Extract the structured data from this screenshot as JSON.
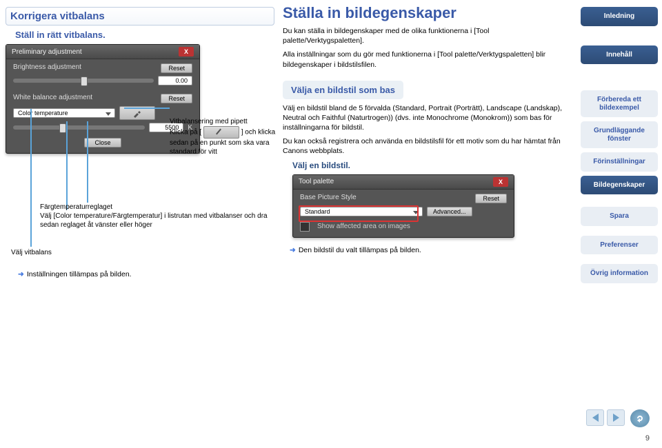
{
  "left": {
    "heading": "Korrigera vitbalans",
    "subStatement": "Ställ in rätt vitbalans.",
    "panel": {
      "title": "Preliminary adjustment",
      "brightnessLabel": "Brightness adjustment",
      "resetLabel": "Reset",
      "brightnessValue": "0.00",
      "whiteBalanceLabel": "White balance adjustment",
      "dropdownValue": "Color temperature",
      "kelvinValue": "5500",
      "kelvinUnit": "K",
      "closeLabel": "Close"
    },
    "annotPipette": "Vitbalansering med pipett",
    "annotPipetteDesc1": "Klicka på [",
    "annotPipetteDesc2": "] och klicka sedan på en punkt som ska vara standard för vitt",
    "annotSliderTitle": "Färgtemperaturreglaget",
    "annotSliderDesc": "Välj [Color temperature/Färgtemperatur] i listrutan med vitbalanser och dra sedan reglaget åt vänster eller höger",
    "annotSelect": "Välj vitbalans",
    "arrowNote": "Inställningen tillämpas på bilden."
  },
  "mid": {
    "bigHeading": "Ställa in bildegenskaper",
    "para1": "Du kan ställa in bildegenskaper med de olika funktionerna i [Tool palette/Verktygspaletten].",
    "para2": "Alla inställningar som du gör med funktionerna i [Tool palette/Verktygspaletten] blir bildegenskaper i bildstilsfilen.",
    "subHeading": "Välja en bildstil som bas",
    "para3": "Välj en bildstil bland de 5 förvalda (Standard, Portrait (Porträtt), Landscape (Landskap), Neutral och Faithful (Naturtrogen)) (dvs. inte Monochrome (Monokrom)) som bas för inställningarna för bildstil.",
    "para4": "Du kan också registrera och använda en bildstilsfil för ett motiv som du har hämtat från Canons webbplats.",
    "statement": "Välj en bildstil.",
    "toolPanel": {
      "title": "Tool palette",
      "baseLabel": "Base Picture Style",
      "resetLabel": "Reset",
      "dropdownValue": "Standard",
      "advancedLabel": "Advanced...",
      "checkboxLabel": "Show affected area on images"
    },
    "arrowNote": "Den bildstil du valt tillämpas på bilden."
  },
  "nav": {
    "items": [
      {
        "label": "Inledning",
        "style": "dark"
      },
      {
        "label": "Innehåll",
        "style": "dark"
      },
      {
        "label": "Förbereda ett bildexempel",
        "style": "light"
      },
      {
        "label": "Grundläggande fönster",
        "style": "light"
      },
      {
        "label": "Förinställningar",
        "style": "light"
      },
      {
        "label": "Bildegenskaper",
        "style": "dark"
      },
      {
        "label": "Spara",
        "style": "light"
      },
      {
        "label": "Preferenser",
        "style": "light"
      },
      {
        "label": "Övrig information",
        "style": "light"
      }
    ]
  },
  "pageNumber": "9"
}
